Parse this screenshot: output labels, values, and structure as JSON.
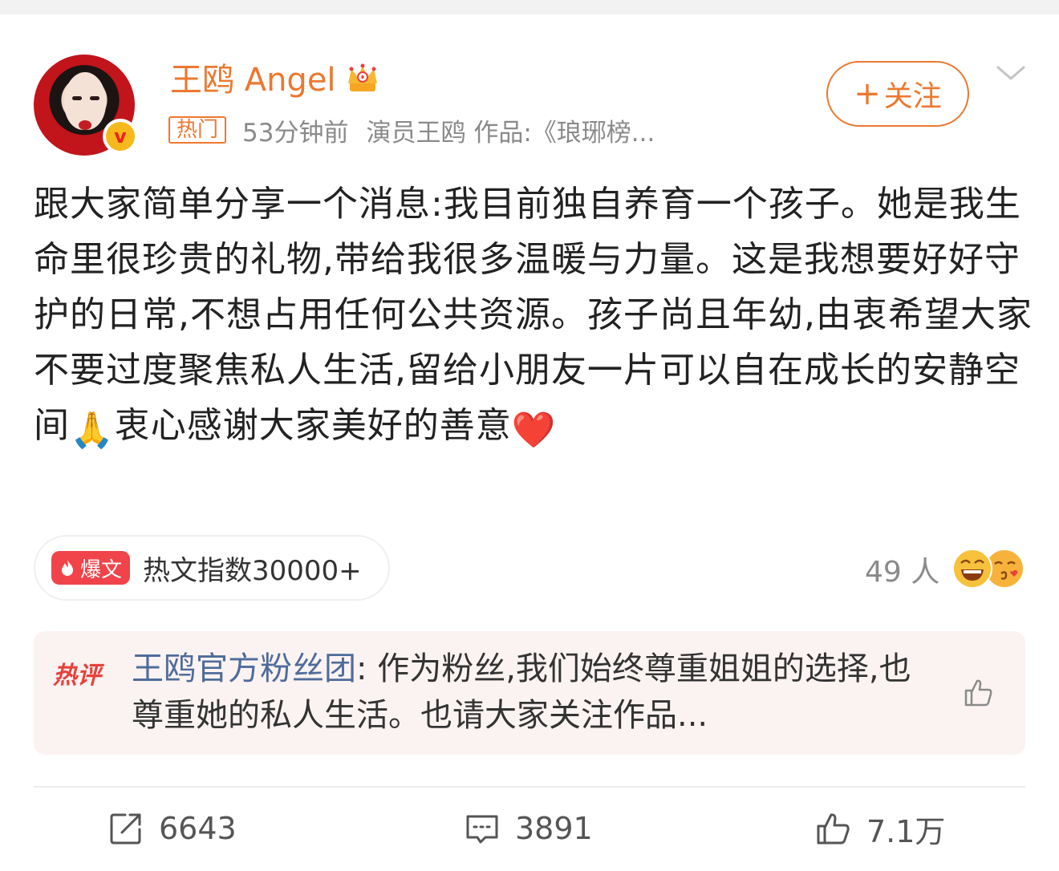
{
  "header": {
    "username": "王鸥 Angel",
    "badge_tag": "热门",
    "time": "53分钟前",
    "source": "演员王鸥 作品:《琅琊榜...",
    "follow_label": "关注",
    "verified_icon": "v-badge-icon",
    "crown_icon": "crown-icon"
  },
  "post": {
    "text_part1": "跟大家简单分享一个消息:我目前独自养育一个孩子。她是我生命里很珍贵的礼物,带给我很多温暖与力量。这是我想要好好守护的日常,不想占用任何公共资源。孩子尚且年幼,由衷希望大家不要过度聚焦私人生活,留给小朋友一片可以自在成长的安静空间",
    "emoji_pray": "🙏",
    "text_part2": "衷心感谢大家美好的善意",
    "emoji_heart": "❤️"
  },
  "hot_index": {
    "badge": "爆文",
    "text": "热文指数30000+"
  },
  "reactions": {
    "count_text": "49 人"
  },
  "hot_comment": {
    "tag": "热评",
    "author": "王鸥官方粉丝团",
    "text": ": 作为粉丝,我们始终尊重姐姐的选择,也尊重她的私人生活。也请大家关注作品..."
  },
  "actions": {
    "repost_count": "6643",
    "comment_count": "3891",
    "like_count": "7.1万"
  },
  "colors": {
    "accent": "#ec7830",
    "hot_red": "#f0444a",
    "author_blue": "#4e6c9a",
    "comment_bg": "#fbf3f2"
  }
}
